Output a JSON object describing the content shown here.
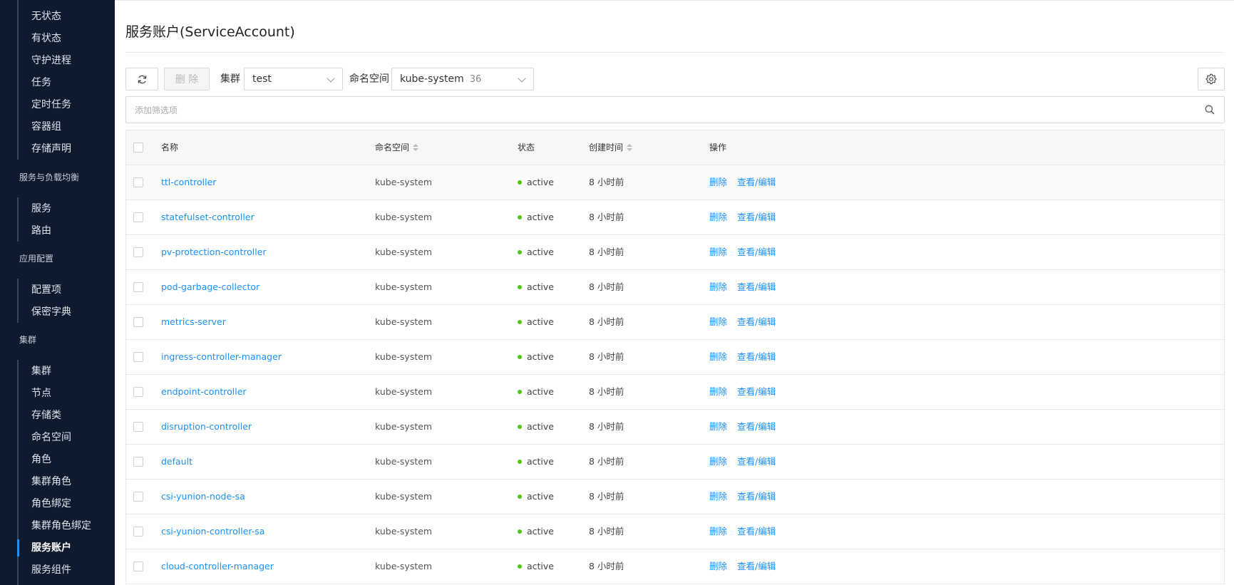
{
  "sidebar": {
    "workload_items": [
      "无状态",
      "有状态",
      "守护进程",
      "任务",
      "定时任务",
      "容器组",
      "存储声明"
    ],
    "group_service": "服务与负载均衡",
    "service_items": [
      "服务",
      "路由"
    ],
    "group_config": "应用配置",
    "config_items": [
      "配置项",
      "保密字典"
    ],
    "group_cluster": "集群",
    "cluster_items": [
      "集群",
      "节点",
      "存储类",
      "命名空间",
      "角色",
      "集群角色",
      "角色绑定",
      "集群角色绑定",
      "服务账户",
      "服务组件"
    ],
    "active_item": "服务账户"
  },
  "page": {
    "title": "服务账户(ServiceAccount)"
  },
  "toolbar": {
    "delete_label": "删 除",
    "cluster_label": "集群",
    "cluster_value": "test",
    "namespace_label": "命名空间",
    "namespace_value": "kube-system",
    "namespace_count": "36"
  },
  "filter": {
    "placeholder": "添加筛选项"
  },
  "table": {
    "headers": {
      "name": "名称",
      "namespace": "命名空间",
      "status": "状态",
      "created": "创建时间",
      "ops": "操作"
    },
    "op_delete": "删除",
    "op_edit": "查看/编辑",
    "rows": [
      {
        "name": "ttl-controller",
        "namespace": "kube-system",
        "status": "active",
        "created": "8 小时前"
      },
      {
        "name": "statefulset-controller",
        "namespace": "kube-system",
        "status": "active",
        "created": "8 小时前"
      },
      {
        "name": "pv-protection-controller",
        "namespace": "kube-system",
        "status": "active",
        "created": "8 小时前"
      },
      {
        "name": "pod-garbage-collector",
        "namespace": "kube-system",
        "status": "active",
        "created": "8 小时前"
      },
      {
        "name": "metrics-server",
        "namespace": "kube-system",
        "status": "active",
        "created": "8 小时前"
      },
      {
        "name": "ingress-controller-manager",
        "namespace": "kube-system",
        "status": "active",
        "created": "8 小时前"
      },
      {
        "name": "endpoint-controller",
        "namespace": "kube-system",
        "status": "active",
        "created": "8 小时前"
      },
      {
        "name": "disruption-controller",
        "namespace": "kube-system",
        "status": "active",
        "created": "8 小时前"
      },
      {
        "name": "default",
        "namespace": "kube-system",
        "status": "active",
        "created": "8 小时前"
      },
      {
        "name": "csi-yunion-node-sa",
        "namespace": "kube-system",
        "status": "active",
        "created": "8 小时前"
      },
      {
        "name": "csi-yunion-controller-sa",
        "namespace": "kube-system",
        "status": "active",
        "created": "8 小时前"
      },
      {
        "name": "cloud-controller-manager",
        "namespace": "kube-system",
        "status": "active",
        "created": "8 小时前"
      }
    ]
  },
  "colors": {
    "sidebar_bg": "#0e1b2e",
    "accent": "#1890ff",
    "status_active": "#52c41a"
  }
}
